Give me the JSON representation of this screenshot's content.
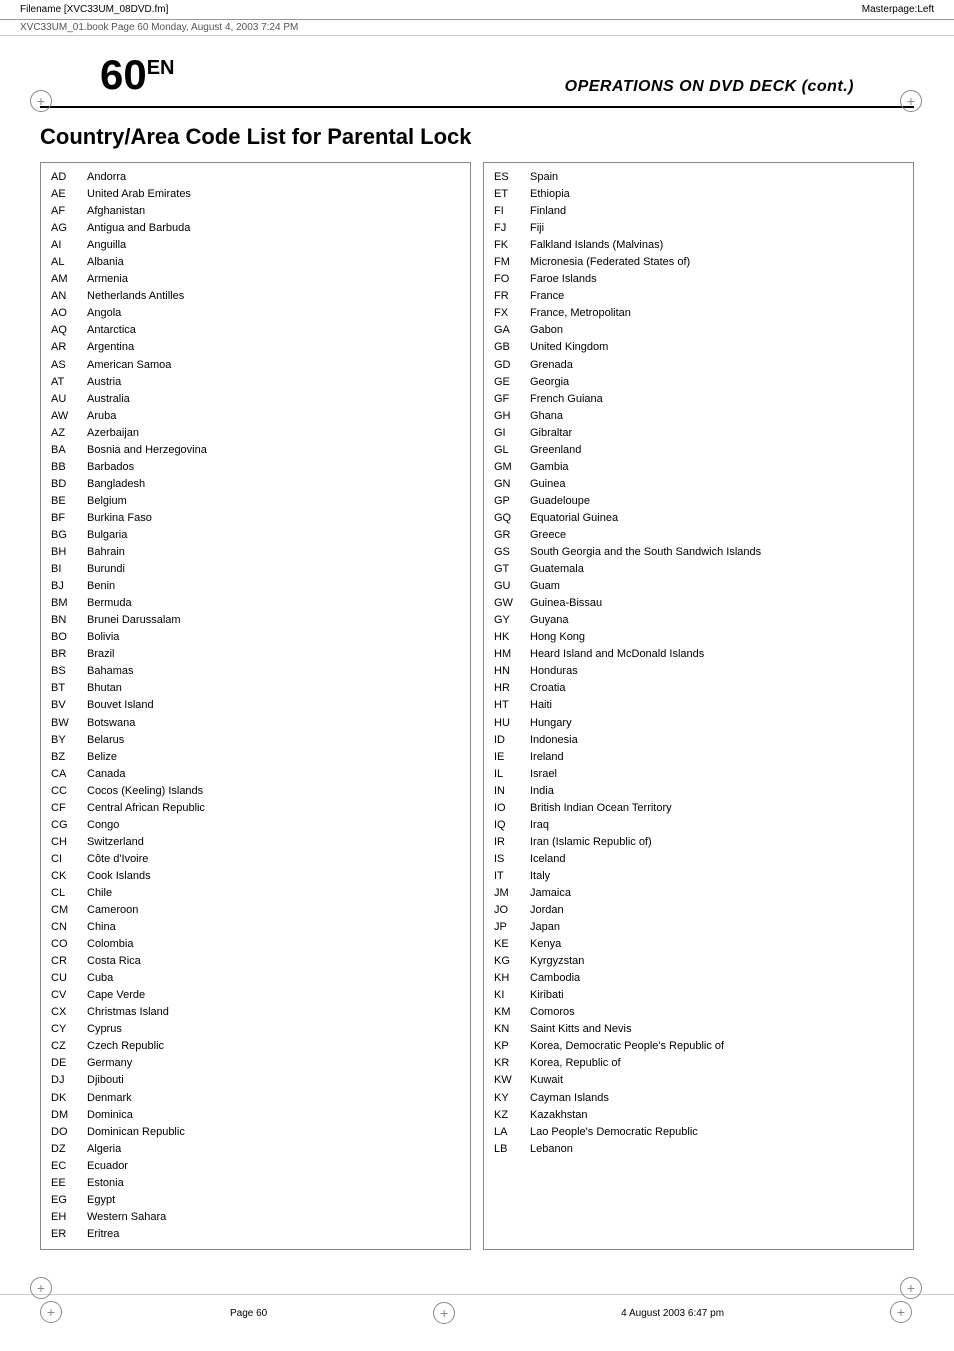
{
  "topBar": {
    "filename": "Filename [XVC33UM_08DVD.fm]",
    "masterpage": "Masterpage:Left"
  },
  "subBar": {
    "text": "XVC33UM_01.book  Page 60  Monday, August 4, 2003  7:24 PM"
  },
  "header": {
    "pageNum": "60",
    "suffix": "EN",
    "title": "OPERATIONS ON DVD DECK (cont.)"
  },
  "sectionHeading": "Country/Area Code List for Parental Lock",
  "leftTable": [
    {
      "code": "AD",
      "name": "Andorra"
    },
    {
      "code": "AE",
      "name": "United Arab Emirates"
    },
    {
      "code": "AF",
      "name": "Afghanistan"
    },
    {
      "code": "AG",
      "name": "Antigua and Barbuda"
    },
    {
      "code": "AI",
      "name": "Anguilla"
    },
    {
      "code": "AL",
      "name": "Albania"
    },
    {
      "code": "AM",
      "name": "Armenia"
    },
    {
      "code": "AN",
      "name": "Netherlands Antilles"
    },
    {
      "code": "AO",
      "name": "Angola"
    },
    {
      "code": "AQ",
      "name": "Antarctica"
    },
    {
      "code": "AR",
      "name": "Argentina"
    },
    {
      "code": "AS",
      "name": "American Samoa"
    },
    {
      "code": "AT",
      "name": "Austria"
    },
    {
      "code": "AU",
      "name": "Australia"
    },
    {
      "code": "AW",
      "name": "Aruba"
    },
    {
      "code": "AZ",
      "name": "Azerbaijan"
    },
    {
      "code": "BA",
      "name": "Bosnia and Herzegovina"
    },
    {
      "code": "BB",
      "name": "Barbados"
    },
    {
      "code": "BD",
      "name": "Bangladesh"
    },
    {
      "code": "BE",
      "name": "Belgium"
    },
    {
      "code": "BF",
      "name": "Burkina Faso"
    },
    {
      "code": "BG",
      "name": "Bulgaria"
    },
    {
      "code": "BH",
      "name": "Bahrain"
    },
    {
      "code": "BI",
      "name": "Burundi"
    },
    {
      "code": "BJ",
      "name": "Benin"
    },
    {
      "code": "BM",
      "name": "Bermuda"
    },
    {
      "code": "BN",
      "name": "Brunei Darussalam"
    },
    {
      "code": "BO",
      "name": "Bolivia"
    },
    {
      "code": "BR",
      "name": "Brazil"
    },
    {
      "code": "BS",
      "name": "Bahamas"
    },
    {
      "code": "BT",
      "name": "Bhutan"
    },
    {
      "code": "BV",
      "name": "Bouvet Island"
    },
    {
      "code": "BW",
      "name": "Botswana"
    },
    {
      "code": "BY",
      "name": "Belarus"
    },
    {
      "code": "BZ",
      "name": "Belize"
    },
    {
      "code": "CA",
      "name": "Canada"
    },
    {
      "code": "CC",
      "name": "Cocos (Keeling) Islands"
    },
    {
      "code": "CF",
      "name": "Central African Republic"
    },
    {
      "code": "CG",
      "name": "Congo"
    },
    {
      "code": "CH",
      "name": "Switzerland"
    },
    {
      "code": "CI",
      "name": "Côte d'Ivoire"
    },
    {
      "code": "CK",
      "name": "Cook Islands"
    },
    {
      "code": "CL",
      "name": "Chile"
    },
    {
      "code": "CM",
      "name": "Cameroon"
    },
    {
      "code": "CN",
      "name": "China"
    },
    {
      "code": "CO",
      "name": "Colombia"
    },
    {
      "code": "CR",
      "name": "Costa Rica"
    },
    {
      "code": "CU",
      "name": "Cuba"
    },
    {
      "code": "CV",
      "name": "Cape Verde"
    },
    {
      "code": "CX",
      "name": "Christmas Island"
    },
    {
      "code": "CY",
      "name": "Cyprus"
    },
    {
      "code": "CZ",
      "name": "Czech Republic"
    },
    {
      "code": "DE",
      "name": "Germany"
    },
    {
      "code": "DJ",
      "name": "Djibouti"
    },
    {
      "code": "DK",
      "name": "Denmark"
    },
    {
      "code": "DM",
      "name": "Dominica"
    },
    {
      "code": "DO",
      "name": "Dominican Republic"
    },
    {
      "code": "DZ",
      "name": "Algeria"
    },
    {
      "code": "EC",
      "name": "Ecuador"
    },
    {
      "code": "EE",
      "name": "Estonia"
    },
    {
      "code": "EG",
      "name": "Egypt"
    },
    {
      "code": "EH",
      "name": "Western Sahara"
    },
    {
      "code": "ER",
      "name": "Eritrea"
    }
  ],
  "rightTable": [
    {
      "code": "ES",
      "name": "Spain"
    },
    {
      "code": "ET",
      "name": "Ethiopia"
    },
    {
      "code": "FI",
      "name": "Finland"
    },
    {
      "code": "FJ",
      "name": "Fiji"
    },
    {
      "code": "FK",
      "name": "Falkland Islands (Malvinas)"
    },
    {
      "code": "FM",
      "name": "Micronesia (Federated States of)"
    },
    {
      "code": "FO",
      "name": "Faroe Islands"
    },
    {
      "code": "FR",
      "name": "France"
    },
    {
      "code": "FX",
      "name": "France, Metropolitan"
    },
    {
      "code": "GA",
      "name": "Gabon"
    },
    {
      "code": "GB",
      "name": "United Kingdom"
    },
    {
      "code": "GD",
      "name": "Grenada"
    },
    {
      "code": "GE",
      "name": "Georgia"
    },
    {
      "code": "GF",
      "name": "French Guiana"
    },
    {
      "code": "GH",
      "name": "Ghana"
    },
    {
      "code": "GI",
      "name": "Gibraltar"
    },
    {
      "code": "GL",
      "name": "Greenland"
    },
    {
      "code": "GM",
      "name": "Gambia"
    },
    {
      "code": "GN",
      "name": "Guinea"
    },
    {
      "code": "GP",
      "name": "Guadeloupe"
    },
    {
      "code": "GQ",
      "name": "Equatorial Guinea"
    },
    {
      "code": "GR",
      "name": "Greece"
    },
    {
      "code": "GS",
      "name": "South Georgia and the South Sandwich Islands"
    },
    {
      "code": "GT",
      "name": "Guatemala"
    },
    {
      "code": "GU",
      "name": "Guam"
    },
    {
      "code": "GW",
      "name": "Guinea-Bissau"
    },
    {
      "code": "GY",
      "name": "Guyana"
    },
    {
      "code": "HK",
      "name": "Hong Kong"
    },
    {
      "code": "HM",
      "name": "Heard Island and McDonald Islands"
    },
    {
      "code": "HN",
      "name": "Honduras"
    },
    {
      "code": "HR",
      "name": "Croatia"
    },
    {
      "code": "HT",
      "name": "Haiti"
    },
    {
      "code": "HU",
      "name": "Hungary"
    },
    {
      "code": "ID",
      "name": "Indonesia"
    },
    {
      "code": "IE",
      "name": "Ireland"
    },
    {
      "code": "IL",
      "name": "Israel"
    },
    {
      "code": "IN",
      "name": "India"
    },
    {
      "code": "IO",
      "name": "British Indian Ocean Territory"
    },
    {
      "code": "IQ",
      "name": "Iraq"
    },
    {
      "code": "IR",
      "name": "Iran (Islamic Republic of)"
    },
    {
      "code": "IS",
      "name": "Iceland"
    },
    {
      "code": "IT",
      "name": "Italy"
    },
    {
      "code": "JM",
      "name": "Jamaica"
    },
    {
      "code": "JO",
      "name": "Jordan"
    },
    {
      "code": "JP",
      "name": "Japan"
    },
    {
      "code": "KE",
      "name": "Kenya"
    },
    {
      "code": "KG",
      "name": "Kyrgyzstan"
    },
    {
      "code": "KH",
      "name": "Cambodia"
    },
    {
      "code": "KI",
      "name": "Kiribati"
    },
    {
      "code": "KM",
      "name": "Comoros"
    },
    {
      "code": "KN",
      "name": "Saint Kitts and Nevis"
    },
    {
      "code": "KP",
      "name": "Korea, Democratic People's Republic of"
    },
    {
      "code": "KR",
      "name": "Korea, Republic of"
    },
    {
      "code": "KW",
      "name": "Kuwait"
    },
    {
      "code": "KY",
      "name": "Cayman Islands"
    },
    {
      "code": "KZ",
      "name": "Kazakhstan"
    },
    {
      "code": "LA",
      "name": "Lao People's Democratic Republic"
    },
    {
      "code": "LB",
      "name": "Lebanon"
    }
  ],
  "footer": {
    "pageLabel": "Page 60",
    "date": "4 August 2003  6:47 pm"
  }
}
